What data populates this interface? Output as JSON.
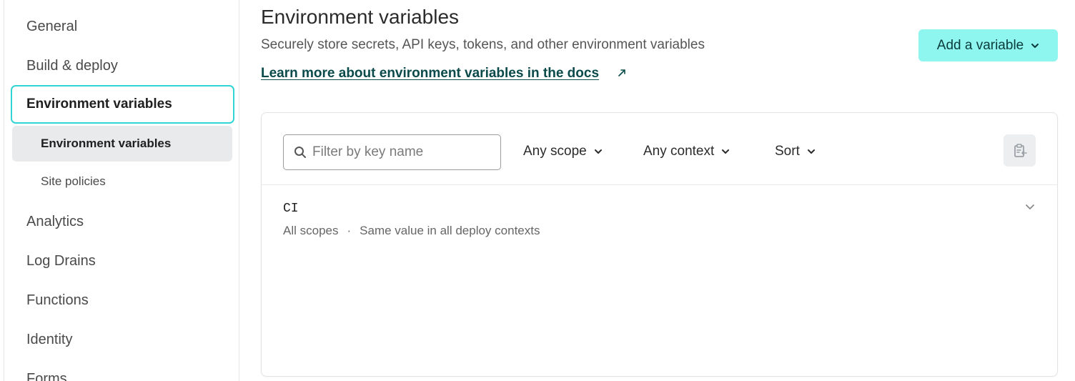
{
  "sidebar": {
    "items": [
      {
        "label": "General"
      },
      {
        "label": "Build & deploy"
      },
      {
        "label": "Environment variables",
        "selected": true
      },
      {
        "label": "Analytics"
      },
      {
        "label": "Log Drains"
      },
      {
        "label": "Functions"
      },
      {
        "label": "Identity"
      },
      {
        "label": "Forms"
      }
    ],
    "sub_items": [
      {
        "label": "Environment variables",
        "active": true
      },
      {
        "label": "Site policies"
      }
    ]
  },
  "header": {
    "title": "Environment variables",
    "description": "Securely store secrets, API keys, tokens, and other environment variables",
    "docs_link": "Learn more about environment variables in the docs",
    "add_button": "Add a variable"
  },
  "toolbar": {
    "filter_placeholder": "Filter by key name",
    "filter_value": "",
    "scope_label": "Any scope",
    "context_label": "Any context",
    "sort_label": "Sort"
  },
  "variables": [
    {
      "key": "CI",
      "scope": "All scopes",
      "separator": "·",
      "context": "Same value in all deploy contexts"
    }
  ],
  "colors": {
    "accent": "#32d4d4",
    "button_bg": "#8ff5ef",
    "link": "#0b4a4a"
  },
  "icons": [
    "search-icon",
    "chevron-down-icon",
    "external-link-icon",
    "clipboard-icon"
  ]
}
